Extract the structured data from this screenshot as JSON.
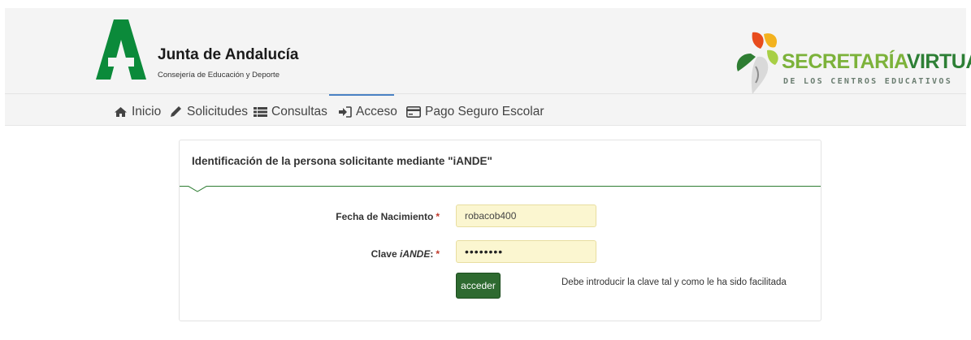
{
  "header": {
    "brand_title": "Junta de Andalucía",
    "brand_subtitle": "Consejería de Educación y Deporte",
    "sv_title_part1": "SECRETARÍA",
    "sv_title_part2": "VIRTUAL",
    "sv_subtitle": "DE LOS CENTROS EDUCATIVOS",
    "colors": {
      "junta_green": "#0b8a3a",
      "sv_green_light": "#7cb23a",
      "sv_green_dark": "#2d7f35"
    }
  },
  "nav": {
    "items": [
      {
        "label": "Inicio",
        "icon": "home-icon"
      },
      {
        "label": "Solicitudes",
        "icon": "pencil-icon"
      },
      {
        "label": "Consultas",
        "icon": "list-icon"
      },
      {
        "label": "Acceso",
        "icon": "sign-in-icon",
        "active": true
      },
      {
        "label": "Pago Seguro Escolar",
        "icon": "credit-card-icon"
      }
    ]
  },
  "form": {
    "title": "Identificación de la persona solicitante mediante \"iANDE\"",
    "birth_label": "Fecha de Nacimiento",
    "required_mark": "*",
    "birth_value": "robacob400",
    "key_label_prefix": "Clave ",
    "key_label_em": "iANDE",
    "key_label_suffix": ":",
    "key_value": "••••••••",
    "submit_label": "acceder",
    "hint": "Debe introducir la clave tal y como le ha sido facilitada"
  }
}
